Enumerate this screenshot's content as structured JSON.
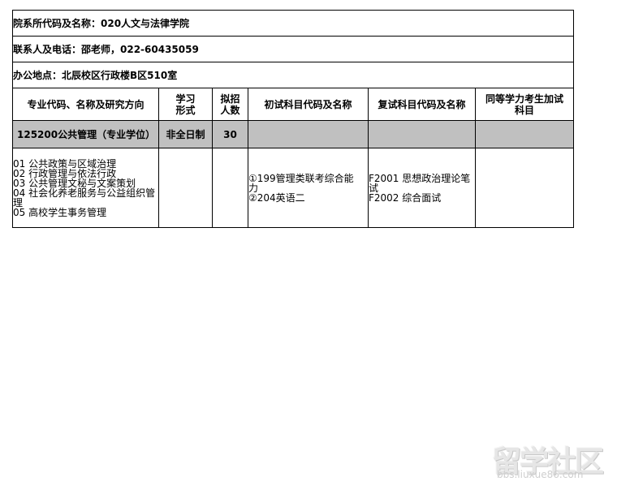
{
  "info": {
    "dept_line": "院系所代码及名称：020人文与法律学院",
    "contact_line": "联系人及电话：邵老师，022-60435059",
    "office_line": "办公地点：北辰校区行政楼B区510室"
  },
  "headers": {
    "major": "专业代码、名称及研究方向",
    "study_mode_l1": "学习",
    "study_mode_l2": "形式",
    "quota_l1": "拟招",
    "quota_l2": "人数",
    "first_exam": "初试科目代码及名称",
    "retest": "复试科目代码及名称",
    "equiv_l1": "同等学力考生加试",
    "equiv_l2": "科目"
  },
  "program": {
    "name": "125200公共管理（专业学位）",
    "study_mode": "非全日制",
    "quota": "30",
    "directions": [
      "01 公共政策与区域治理",
      "02 行政管理与依法行政",
      "03 公共管理文秘与文案策划",
      "04 社会化养老服务与公益组织管",
      "理",
      "05 高校学生事务管理"
    ],
    "first_exam_lines": [
      "①199管理类联考综合能",
      "力",
      "②204英语二"
    ],
    "retest_lines": [
      "F2001 思想政治理论笔",
      "试",
      "F2002 综合面试"
    ]
  },
  "watermark": {
    "brand": "留学社区",
    "url": "bbs.liuxue86.com"
  }
}
